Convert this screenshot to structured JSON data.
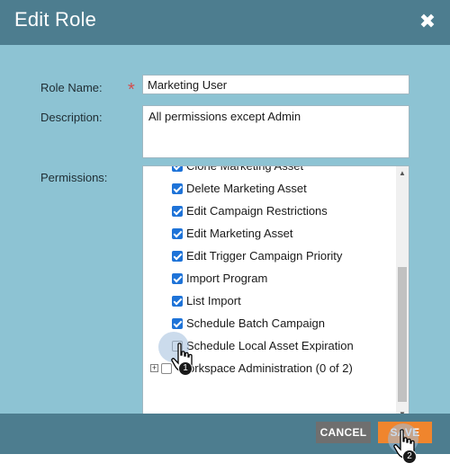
{
  "dialog": {
    "title": "Edit Role",
    "close_label": "✖"
  },
  "form": {
    "role_name_label": "Role Name:",
    "required_marker": "*",
    "role_name_value": "Marketing User",
    "description_label": "Description:",
    "description_value": "All permissions except Admin",
    "permissions_label": "Permissions:"
  },
  "permissions": [
    {
      "label": "Clone Marketing Asset",
      "checked": true
    },
    {
      "label": "Delete Marketing Asset",
      "checked": true
    },
    {
      "label": "Edit Campaign Restrictions",
      "checked": true
    },
    {
      "label": "Edit Marketing Asset",
      "checked": true
    },
    {
      "label": "Edit Trigger Campaign Priority",
      "checked": true
    },
    {
      "label": "Import Program",
      "checked": true
    },
    {
      "label": "List Import",
      "checked": true
    },
    {
      "label": "Schedule Batch Campaign",
      "checked": true
    },
    {
      "label": "Schedule Local Asset Expiration",
      "checked": false
    },
    {
      "label": "Workspace Administration (0 of 2)",
      "checked": false,
      "expandable": true
    }
  ],
  "footer": {
    "cancel_label": "CANCEL",
    "save_label": "SAVE"
  },
  "annotations": {
    "step1": "1",
    "step2": "2"
  },
  "colors": {
    "header": "#4d7d8f",
    "body": "#8dc3d3",
    "save": "#f0852d",
    "cancel": "#6f6f6f",
    "checkbox": "#1e73d8"
  }
}
